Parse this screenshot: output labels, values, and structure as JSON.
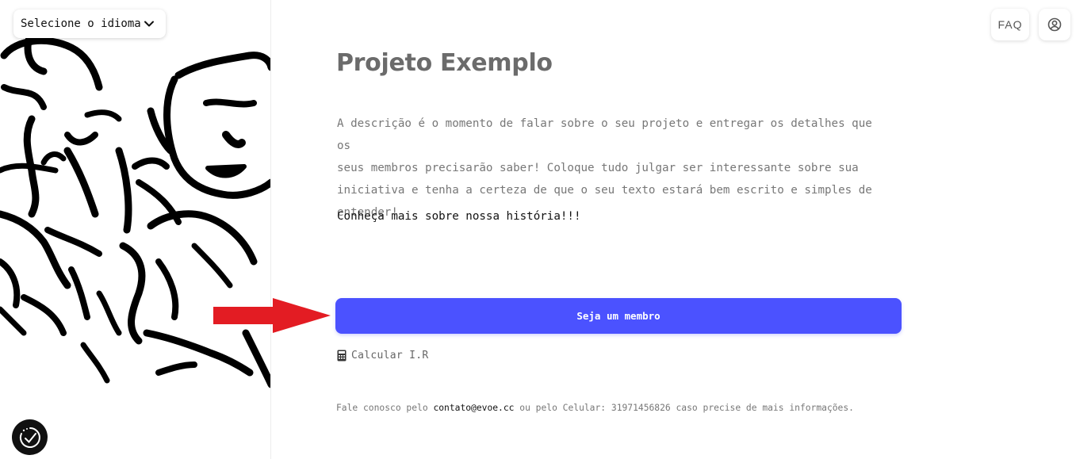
{
  "language_select": {
    "label": "Selecione o idioma",
    "icon": "chevron-down-icon"
  },
  "header": {
    "faq_label": "FAQ",
    "account_icon": "user-circle-icon"
  },
  "project": {
    "title": "Projeto Exemplo",
    "description_lines": [
      "A descrição é o momento de falar sobre o seu projeto e entregar os detalhes que os",
      "seus membros precisarão saber! Coloque tudo julgar ser interessante sobre sua",
      "iniciativa e tenha a certeza de que o seu texto estará bem escrito e simples de",
      "entender!"
    ],
    "cta_text": "Conheça mais sobre nossa história!!!"
  },
  "actions": {
    "member_button": "Seja um membro",
    "calculator_link": "Calcular I.R",
    "calculator_icon": "calculator-icon"
  },
  "contact": {
    "prefix": "Fale conosco pelo ",
    "email": "contato@evoe.cc",
    "suffix": " ou pelo Celular: 31971456826 caso precise de mais informações."
  },
  "colors": {
    "primary": "#4b52ff",
    "arrow": "#e31c23",
    "title": "#6b6b6b"
  }
}
